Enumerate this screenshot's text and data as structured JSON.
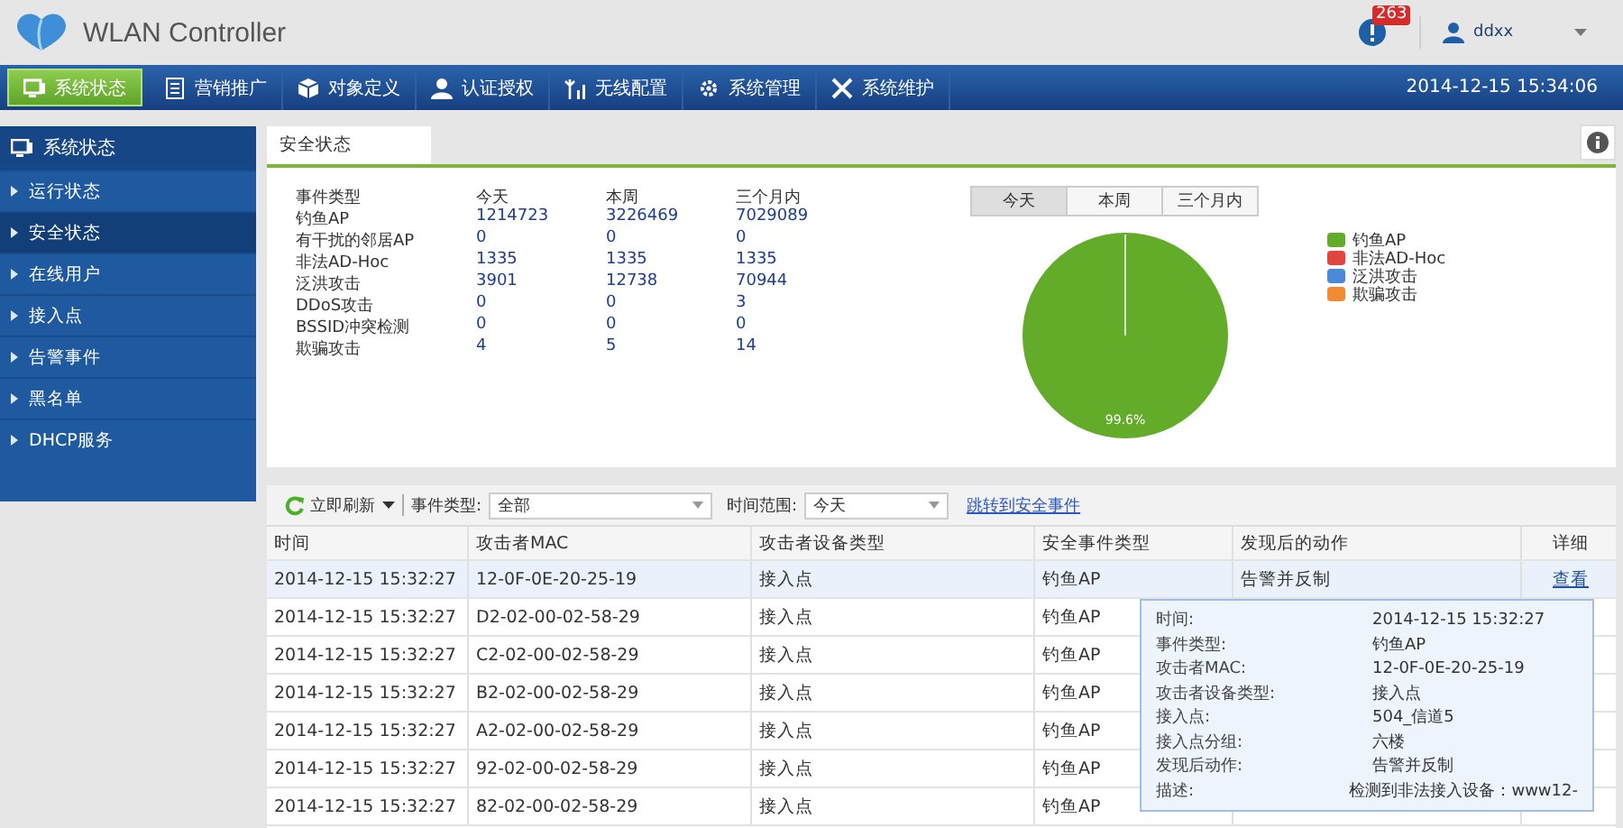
{
  "header": {
    "title": "WLAN Controller",
    "alarm_count": "263",
    "user": "ddxx"
  },
  "nav": {
    "items": [
      {
        "label": "系统状态",
        "selected": true
      },
      {
        "label": "营销推广",
        "selected": false
      },
      {
        "label": "对象定义",
        "selected": false
      },
      {
        "label": "认证授权",
        "selected": false
      },
      {
        "label": "无线配置",
        "selected": false
      },
      {
        "label": "系统管理",
        "selected": false
      },
      {
        "label": "系统维护",
        "selected": false
      }
    ],
    "datetime": "2014-12-15 15:34:06"
  },
  "sidebar": {
    "title": "系统状态",
    "items": [
      {
        "label": "运行状态",
        "selected": false
      },
      {
        "label": "安全状态",
        "selected": true
      },
      {
        "label": "在线用户",
        "selected": false
      },
      {
        "label": "接入点",
        "selected": false
      },
      {
        "label": "告警事件",
        "selected": false
      },
      {
        "label": "黑名单",
        "selected": false
      },
      {
        "label": "DHCP服务",
        "selected": false
      }
    ]
  },
  "panel_tab": "安全状态",
  "stats": {
    "columns": [
      "事件类型",
      "今天",
      "本周",
      "三个月内"
    ],
    "rows": [
      [
        "钓鱼AP",
        "1214723",
        "3226469",
        "7029089"
      ],
      [
        "有干扰的邻居AP",
        "0",
        "0",
        "0"
      ],
      [
        "非法AD-Hoc",
        "1335",
        "1335",
        "1335"
      ],
      [
        "泛洪攻击",
        "3901",
        "12738",
        "70944"
      ],
      [
        "DDoS攻击",
        "0",
        "0",
        "3"
      ],
      [
        "BSSID冲突检测",
        "0",
        "0",
        "0"
      ],
      [
        "欺骗攻击",
        "4",
        "5",
        "14"
      ]
    ]
  },
  "period_tabs": [
    {
      "label": "今天",
      "selected": true
    },
    {
      "label": "本周",
      "selected": false
    },
    {
      "label": "三个月内",
      "selected": false
    }
  ],
  "pie": {
    "slice_label": "99.6%",
    "legend": [
      {
        "label": "钓鱼AP",
        "color": "#62ac2a"
      },
      {
        "label": "非法AD-Hoc",
        "color": "#e0453f"
      },
      {
        "label": "泛洪攻击",
        "color": "#4a88d8"
      },
      {
        "label": "欺骗攻击",
        "color": "#f28a32"
      }
    ]
  },
  "toolbar": {
    "refresh": "立即刷新",
    "event_type_label": "事件类型:",
    "event_type": "全部",
    "time_range_label": "时间范围:",
    "time_range": "今天",
    "link": "跳转到安全事件"
  },
  "table": {
    "columns": [
      "时间",
      "攻击者MAC",
      "攻击者设备类型",
      "安全事件类型",
      "发现后的动作",
      "详细"
    ],
    "rows": [
      {
        "time": "2014-12-15 15:32:27",
        "mac": "12-0F-0E-20-25-19",
        "device": "接入点",
        "event": "钓鱼AP",
        "action": "告警并反制",
        "detail": "查看",
        "selected": true
      },
      {
        "time": "2014-12-15 15:32:27",
        "mac": "D2-02-00-02-58-29",
        "device": "接入点",
        "event": "钓鱼AP",
        "selected": false
      },
      {
        "time": "2014-12-15 15:32:27",
        "mac": "C2-02-00-02-58-29",
        "device": "接入点",
        "event": "钓鱼AP",
        "selected": false
      },
      {
        "time": "2014-12-15 15:32:27",
        "mac": "B2-02-00-02-58-29",
        "device": "接入点",
        "event": "钓鱼AP",
        "selected": false
      },
      {
        "time": "2014-12-15 15:32:27",
        "mac": "A2-02-00-02-58-29",
        "device": "接入点",
        "event": "钓鱼AP",
        "selected": false
      },
      {
        "time": "2014-12-15 15:32:27",
        "mac": "92-02-00-02-58-29",
        "device": "接入点",
        "event": "钓鱼AP",
        "selected": false
      },
      {
        "time": "2014-12-15 15:32:27",
        "mac": "82-02-00-02-58-29",
        "device": "接入点",
        "event": "钓鱼AP",
        "selected": false
      }
    ]
  },
  "tooltip": [
    {
      "label": "时间:",
      "value": "2014-12-15 15:32:27"
    },
    {
      "label": "事件类型:",
      "value": "钓鱼AP"
    },
    {
      "label": "攻击者MAC:",
      "value": "12-0F-0E-20-25-19"
    },
    {
      "label": "攻击者设备类型:",
      "value": "接入点"
    },
    {
      "label": "接入点:",
      "value": "504_信道5"
    },
    {
      "label": "接入点分组:",
      "value": "六楼"
    },
    {
      "label": "发现后动作:",
      "value": "告警并反制"
    },
    {
      "label": "描述:",
      "value": "检测到非法接入设备：www12-"
    }
  ]
}
